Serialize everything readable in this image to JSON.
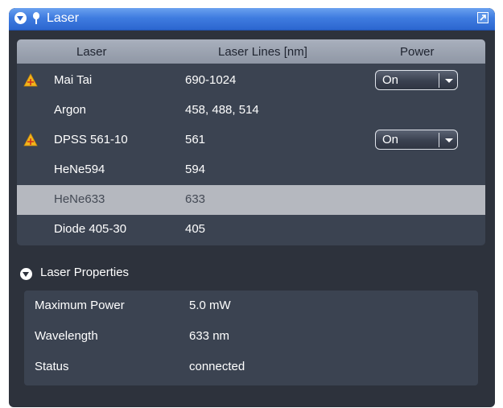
{
  "header": {
    "title": "Laser",
    "collapse_icon": "chevron-down-circle-icon",
    "pin_icon": "pin-icon",
    "undock_icon": "undock-window-icon"
  },
  "laser_table": {
    "columns": [
      "Laser",
      "Laser Lines [nm]",
      "Power"
    ],
    "rows": [
      {
        "name": "Mai Tai",
        "lines": "690-1024",
        "power": "On",
        "warning": true
      },
      {
        "name": "Argon",
        "lines": "458, 488, 514",
        "power": "",
        "warning": false
      },
      {
        "name": "DPSS 561-10",
        "lines": "561",
        "power": "On",
        "warning": true
      },
      {
        "name": "HeNe594",
        "lines": "594",
        "power": "",
        "warning": false
      },
      {
        "name": "HeNe633",
        "lines": "633",
        "power": "",
        "warning": false,
        "selected": true
      },
      {
        "name": "Diode 405-30",
        "lines": "405",
        "power": "",
        "warning": false
      }
    ]
  },
  "properties": {
    "title": "Laser Properties",
    "rows": [
      {
        "label": "Maximum Power",
        "value": "5.0 mW"
      },
      {
        "label": "Wavelength",
        "value": "633 nm"
      },
      {
        "label": "Status",
        "value": "connected"
      }
    ]
  },
  "colors": {
    "titlebar": "#3f7ce0",
    "panel": "#2d323c",
    "table": "#3b4351",
    "selected_row": "#b5b8bf",
    "warning": "#f2b51c"
  }
}
